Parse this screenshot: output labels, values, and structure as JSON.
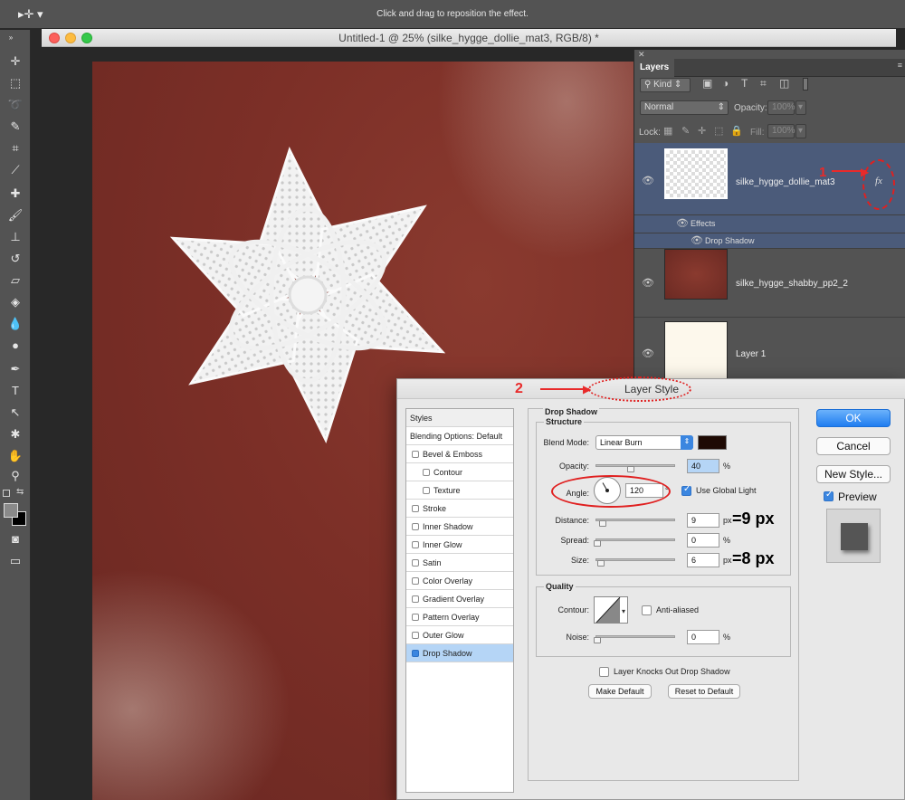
{
  "options_bar": {
    "hint": "Click and drag to reposition the effect."
  },
  "document": {
    "title": "Untitled-1 @ 25% (silke_hygge_dollie_mat3, RGB/8) *"
  },
  "layers_panel": {
    "tab": "Layers",
    "filter_kind": "Kind",
    "blend_mode": "Normal",
    "opacity_label": "Opacity:",
    "opacity_value": "100%",
    "lock_label": "Lock:",
    "fill_label": "Fill:",
    "fill_value": "100%",
    "layers": [
      {
        "name": "silke_hygge_dollie_mat3",
        "selected": true,
        "fx": "fx"
      },
      {
        "name": "silke_hygge_shabby_pp2_2",
        "selected": false
      },
      {
        "name": "Layer 1",
        "selected": false
      }
    ],
    "effects_label": "Effects",
    "effect_name": "Drop Shadow"
  },
  "annotations": {
    "marker1": "1",
    "marker2": "2",
    "distance_note": "=9 px",
    "size_note": "=8 px"
  },
  "dialog": {
    "title": "Layer Style",
    "styles_header": "Styles",
    "blending_options": "Blending Options: Default",
    "style_items": [
      {
        "label": "Bevel & Emboss",
        "checked": false,
        "indent": false
      },
      {
        "label": "Contour",
        "checked": false,
        "indent": true
      },
      {
        "label": "Texture",
        "checked": false,
        "indent": true
      },
      {
        "label": "Stroke",
        "checked": false,
        "indent": false
      },
      {
        "label": "Inner Shadow",
        "checked": false,
        "indent": false
      },
      {
        "label": "Inner Glow",
        "checked": false,
        "indent": false
      },
      {
        "label": "Satin",
        "checked": false,
        "indent": false
      },
      {
        "label": "Color Overlay",
        "checked": false,
        "indent": false
      },
      {
        "label": "Gradient Overlay",
        "checked": false,
        "indent": false
      },
      {
        "label": "Pattern Overlay",
        "checked": false,
        "indent": false
      },
      {
        "label": "Outer Glow",
        "checked": false,
        "indent": false
      },
      {
        "label": "Drop Shadow",
        "checked": true,
        "indent": false,
        "selected": true
      }
    ],
    "drop_shadow": {
      "section_title": "Drop Shadow",
      "structure_title": "Structure",
      "blend_mode_label": "Blend Mode:",
      "blend_mode": "Linear Burn",
      "shadow_color": "#1e0a04",
      "opacity_label": "Opacity:",
      "opacity": "40",
      "opacity_unit": "%",
      "angle_label": "Angle:",
      "angle": "120",
      "angle_unit": "°",
      "use_global_light": "Use Global Light",
      "distance_label": "Distance:",
      "distance": "9",
      "distance_unit": "px",
      "spread_label": "Spread:",
      "spread": "0",
      "spread_unit": "%",
      "size_label": "Size:",
      "size": "6",
      "size_unit": "px",
      "quality_title": "Quality",
      "contour_label": "Contour:",
      "anti_aliased": "Anti-aliased",
      "noise_label": "Noise:",
      "noise": "0",
      "noise_unit": "%",
      "knocks_out": "Layer Knocks Out Drop Shadow",
      "make_default": "Make Default",
      "reset_default": "Reset to Default"
    },
    "buttons": {
      "ok": "OK",
      "cancel": "Cancel",
      "new_style": "New Style...",
      "preview": "Preview"
    }
  }
}
